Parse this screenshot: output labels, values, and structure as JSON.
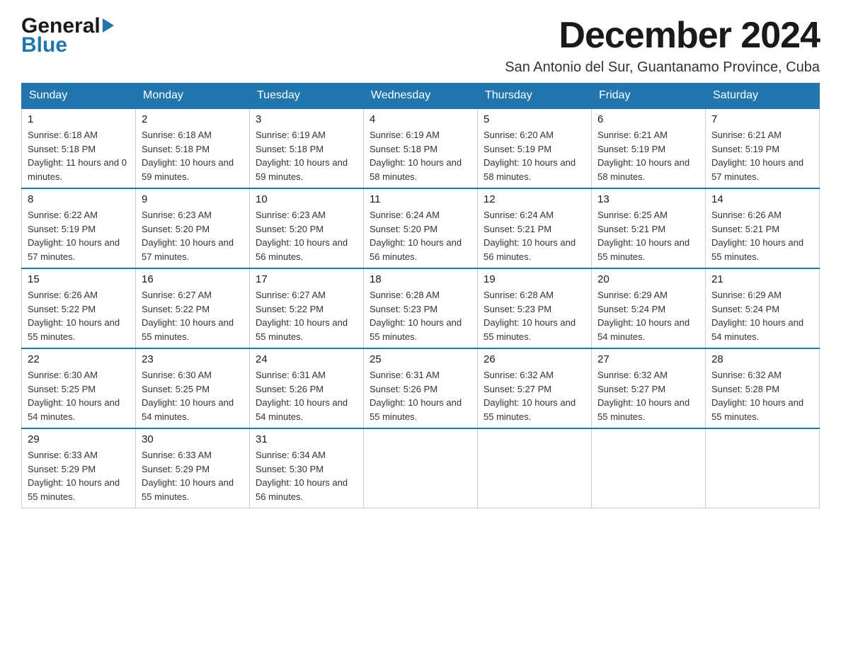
{
  "logo": {
    "general": "General",
    "blue": "Blue"
  },
  "header": {
    "month_year": "December 2024",
    "location": "San Antonio del Sur, Guantanamo Province, Cuba"
  },
  "weekdays": [
    "Sunday",
    "Monday",
    "Tuesday",
    "Wednesday",
    "Thursday",
    "Friday",
    "Saturday"
  ],
  "weeks": [
    [
      {
        "day": "1",
        "sunrise": "6:18 AM",
        "sunset": "5:18 PM",
        "daylight": "11 hours and 0 minutes."
      },
      {
        "day": "2",
        "sunrise": "6:18 AM",
        "sunset": "5:18 PM",
        "daylight": "10 hours and 59 minutes."
      },
      {
        "day": "3",
        "sunrise": "6:19 AM",
        "sunset": "5:18 PM",
        "daylight": "10 hours and 59 minutes."
      },
      {
        "day": "4",
        "sunrise": "6:19 AM",
        "sunset": "5:18 PM",
        "daylight": "10 hours and 58 minutes."
      },
      {
        "day": "5",
        "sunrise": "6:20 AM",
        "sunset": "5:19 PM",
        "daylight": "10 hours and 58 minutes."
      },
      {
        "day": "6",
        "sunrise": "6:21 AM",
        "sunset": "5:19 PM",
        "daylight": "10 hours and 58 minutes."
      },
      {
        "day": "7",
        "sunrise": "6:21 AM",
        "sunset": "5:19 PM",
        "daylight": "10 hours and 57 minutes."
      }
    ],
    [
      {
        "day": "8",
        "sunrise": "6:22 AM",
        "sunset": "5:19 PM",
        "daylight": "10 hours and 57 minutes."
      },
      {
        "day": "9",
        "sunrise": "6:23 AM",
        "sunset": "5:20 PM",
        "daylight": "10 hours and 57 minutes."
      },
      {
        "day": "10",
        "sunrise": "6:23 AM",
        "sunset": "5:20 PM",
        "daylight": "10 hours and 56 minutes."
      },
      {
        "day": "11",
        "sunrise": "6:24 AM",
        "sunset": "5:20 PM",
        "daylight": "10 hours and 56 minutes."
      },
      {
        "day": "12",
        "sunrise": "6:24 AM",
        "sunset": "5:21 PM",
        "daylight": "10 hours and 56 minutes."
      },
      {
        "day": "13",
        "sunrise": "6:25 AM",
        "sunset": "5:21 PM",
        "daylight": "10 hours and 55 minutes."
      },
      {
        "day": "14",
        "sunrise": "6:26 AM",
        "sunset": "5:21 PM",
        "daylight": "10 hours and 55 minutes."
      }
    ],
    [
      {
        "day": "15",
        "sunrise": "6:26 AM",
        "sunset": "5:22 PM",
        "daylight": "10 hours and 55 minutes."
      },
      {
        "day": "16",
        "sunrise": "6:27 AM",
        "sunset": "5:22 PM",
        "daylight": "10 hours and 55 minutes."
      },
      {
        "day": "17",
        "sunrise": "6:27 AM",
        "sunset": "5:22 PM",
        "daylight": "10 hours and 55 minutes."
      },
      {
        "day": "18",
        "sunrise": "6:28 AM",
        "sunset": "5:23 PM",
        "daylight": "10 hours and 55 minutes."
      },
      {
        "day": "19",
        "sunrise": "6:28 AM",
        "sunset": "5:23 PM",
        "daylight": "10 hours and 55 minutes."
      },
      {
        "day": "20",
        "sunrise": "6:29 AM",
        "sunset": "5:24 PM",
        "daylight": "10 hours and 54 minutes."
      },
      {
        "day": "21",
        "sunrise": "6:29 AM",
        "sunset": "5:24 PM",
        "daylight": "10 hours and 54 minutes."
      }
    ],
    [
      {
        "day": "22",
        "sunrise": "6:30 AM",
        "sunset": "5:25 PM",
        "daylight": "10 hours and 54 minutes."
      },
      {
        "day": "23",
        "sunrise": "6:30 AM",
        "sunset": "5:25 PM",
        "daylight": "10 hours and 54 minutes."
      },
      {
        "day": "24",
        "sunrise": "6:31 AM",
        "sunset": "5:26 PM",
        "daylight": "10 hours and 54 minutes."
      },
      {
        "day": "25",
        "sunrise": "6:31 AM",
        "sunset": "5:26 PM",
        "daylight": "10 hours and 55 minutes."
      },
      {
        "day": "26",
        "sunrise": "6:32 AM",
        "sunset": "5:27 PM",
        "daylight": "10 hours and 55 minutes."
      },
      {
        "day": "27",
        "sunrise": "6:32 AM",
        "sunset": "5:27 PM",
        "daylight": "10 hours and 55 minutes."
      },
      {
        "day": "28",
        "sunrise": "6:32 AM",
        "sunset": "5:28 PM",
        "daylight": "10 hours and 55 minutes."
      }
    ],
    [
      {
        "day": "29",
        "sunrise": "6:33 AM",
        "sunset": "5:29 PM",
        "daylight": "10 hours and 55 minutes."
      },
      {
        "day": "30",
        "sunrise": "6:33 AM",
        "sunset": "5:29 PM",
        "daylight": "10 hours and 55 minutes."
      },
      {
        "day": "31",
        "sunrise": "6:34 AM",
        "sunset": "5:30 PM",
        "daylight": "10 hours and 56 minutes."
      },
      null,
      null,
      null,
      null
    ]
  ]
}
